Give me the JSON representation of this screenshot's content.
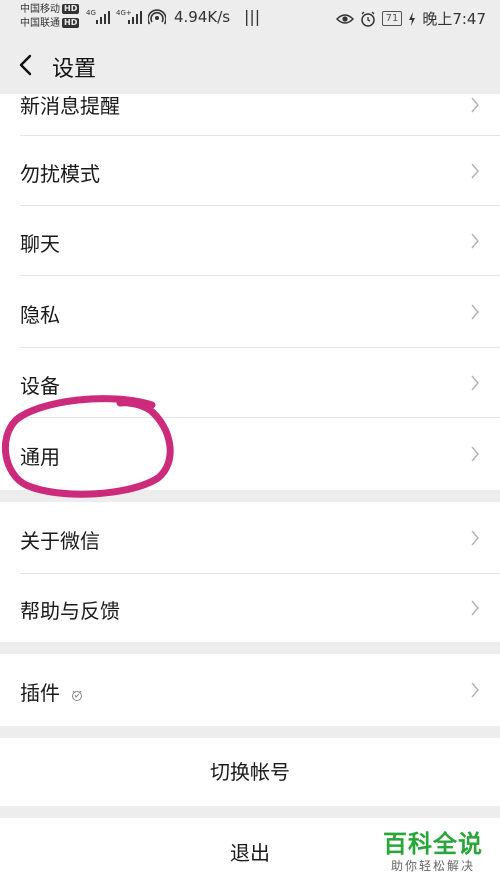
{
  "status": {
    "carrier1": "中国移动",
    "carrier2": "中国联通",
    "hd": "HD",
    "net1": "4G",
    "net2": "4G+",
    "speed": "4.94K/s",
    "app_glyph": "|||",
    "battery": "71",
    "time": "晚上7:47"
  },
  "nav": {
    "title": "设置"
  },
  "settings": {
    "items": [
      {
        "label": "新消息提醒"
      },
      {
        "label": "勿扰模式"
      },
      {
        "label": "聊天"
      },
      {
        "label": "隐私"
      },
      {
        "label": "设备"
      },
      {
        "label": "通用"
      },
      {
        "label": "关于微信"
      },
      {
        "label": "帮助与反馈"
      },
      {
        "label": "插件"
      }
    ],
    "switch_account": "切换帐号",
    "logout": "退出"
  },
  "annotation": {
    "color": "#cc2a7a"
  },
  "watermark": {
    "title": "百科全说",
    "subtitle": "助你轻松解决"
  }
}
